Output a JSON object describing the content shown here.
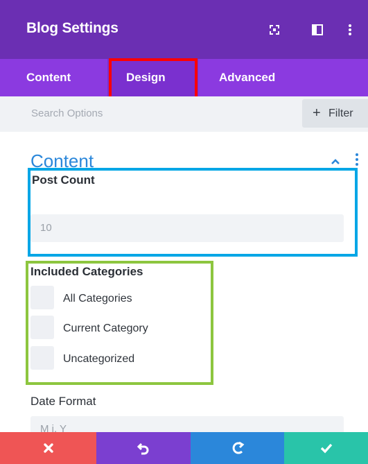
{
  "header": {
    "title": "Blog Settings",
    "icons": [
      "fullscreen-icon",
      "split-view-icon",
      "more-vertical-icon"
    ],
    "background": "#6b2fb3"
  },
  "tabs": [
    {
      "label": "Content",
      "active": false
    },
    {
      "label": "Design",
      "active": true
    },
    {
      "label": "Advanced",
      "active": false
    }
  ],
  "search": {
    "placeholder": "Search Options",
    "filter_label": "Filter"
  },
  "section": {
    "title": "Content"
  },
  "fields": {
    "post_count": {
      "label": "Post Count",
      "value": "10"
    },
    "included_categories": {
      "label": "Included Categories",
      "options": [
        "All Categories",
        "Current Category",
        "Uncategorized"
      ]
    },
    "date_format": {
      "label": "Date Format",
      "value": "M j, Y"
    }
  },
  "footer": {
    "buttons": [
      {
        "name": "discard",
        "icon": "close-icon",
        "color": "#ef5555"
      },
      {
        "name": "undo",
        "icon": "undo-icon",
        "color": "#7b3fd0"
      },
      {
        "name": "redo",
        "icon": "redo-icon",
        "color": "#2b87da"
      },
      {
        "name": "save",
        "icon": "checkmark-icon",
        "color": "#29c4a9"
      }
    ]
  },
  "colors": {
    "accent": "#2b87da",
    "tab_bar": "#8b3ae0",
    "highlight_red": "#ff0000",
    "highlight_blue": "#00a6e6",
    "highlight_green": "#8dc63f"
  }
}
